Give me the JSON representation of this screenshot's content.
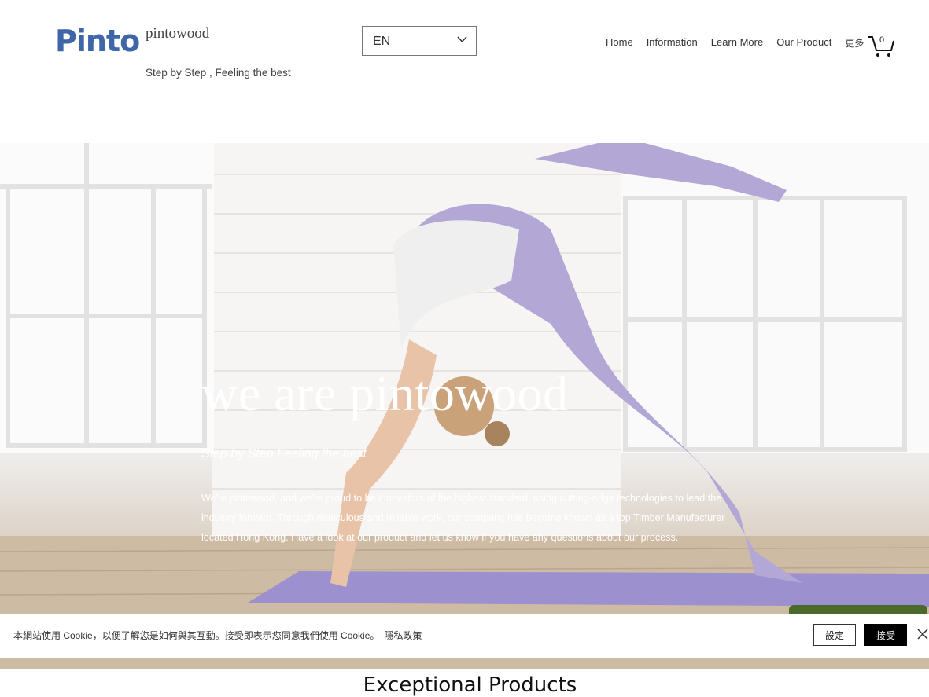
{
  "header": {
    "logo": "Pinto",
    "site_name": "pintowood",
    "tagline": "Step by Step , Feeling the best",
    "language": "EN",
    "nav": [
      "Home",
      "Information",
      "Learn More",
      "Our Product",
      "更多"
    ],
    "cart_count": "0"
  },
  "hero": {
    "title": "we are pintowood",
    "subtitle": "Step by Step,Feeling the best",
    "body": "We're pintowood, and we're proud to be innovators of the highest standard, using cutting-edge technologies to lead the industry forward. Through meticulous and reliable work, our company has become known as a top Timber Manufacturer located Hong Kong. Have a look at our product and let us know if you have any questions about our process."
  },
  "cookie": {
    "text": "本網站使用 Cookie，以便了解您是如何與其互動。接受即表示您同意我們使用 Cookie。",
    "policy_link": "隱私政策",
    "settings_label": "設定",
    "accept_label": "接受"
  },
  "section": {
    "heading": "Exceptional Products"
  },
  "colors": {
    "logo": "#3f66a8",
    "mat": "#9d90cf",
    "accept_bg": "#000000"
  },
  "icons": [
    "chevron-down-icon",
    "cart-icon",
    "close-icon"
  ]
}
